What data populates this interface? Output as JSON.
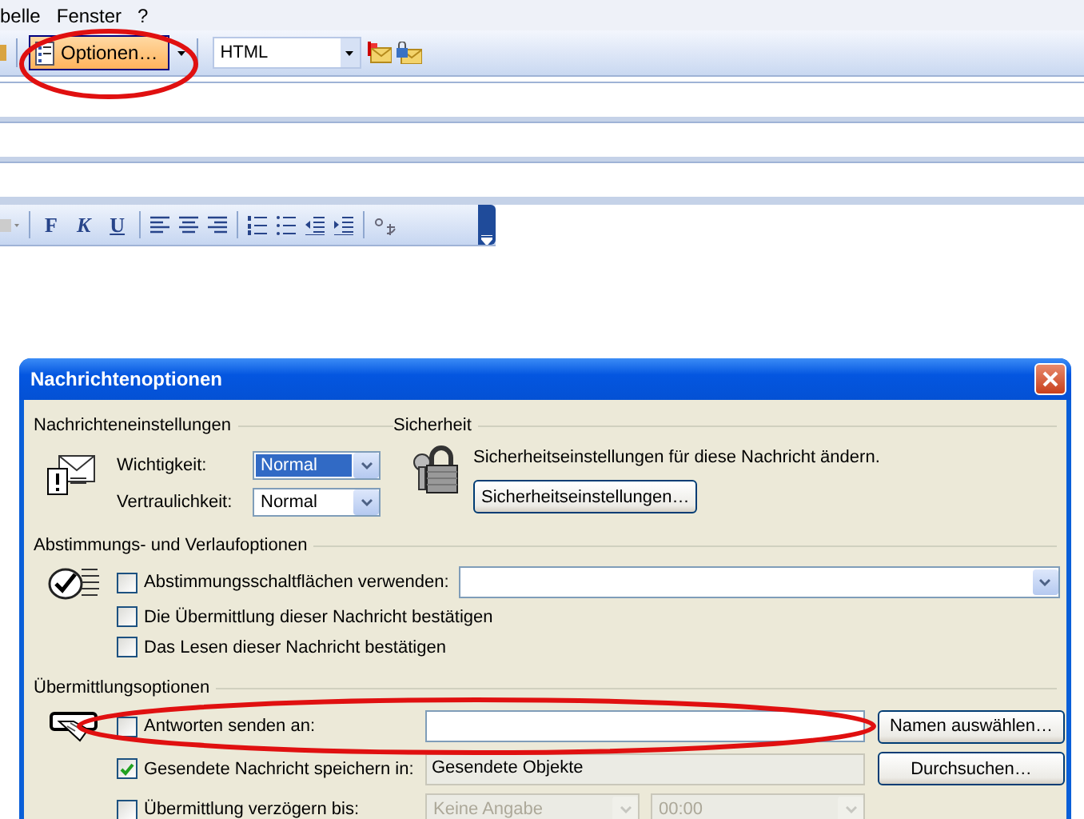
{
  "menu": [
    {
      "label": "belle"
    },
    {
      "label": "Fenster"
    },
    {
      "label": "?"
    }
  ],
  "toolbar": {
    "options_button": {
      "label": "Optionen…",
      "highlighted": true
    },
    "format_combo": {
      "value": "HTML"
    }
  },
  "format_toolbar": {
    "style_buttons": [
      {
        "label": "F",
        "kind": "bold"
      },
      {
        "label": "K",
        "kind": "italic"
      },
      {
        "label": "U",
        "kind": "underline"
      }
    ]
  },
  "dialog": {
    "title": "Nachrichtenoptionen",
    "settings": {
      "heading": "Nachrichteneinstellungen",
      "fields": [
        {
          "label": "Wichtigkeit:",
          "value": "Normal",
          "selected": true
        },
        {
          "label": "Vertraulichkeit:",
          "value": "Normal",
          "selected": false
        }
      ]
    },
    "security": {
      "heading": "Sicherheit",
      "text": "Sicherheitseinstellungen für diese Nachricht ändern.",
      "button": "Sicherheitseinstellungen…"
    },
    "tracking": {
      "heading": "Abstimmungs- und Verlaufoptionen",
      "options": [
        {
          "kind": "combo",
          "label": "Abstimmungsschaltflächen verwenden:",
          "checked": false
        },
        {
          "kind": "plain",
          "label": "Die Übermittlung dieser Nachricht bestätigen",
          "checked": false
        },
        {
          "kind": "plain",
          "label": "Das Lesen dieser Nachricht bestätigen",
          "checked": false
        }
      ]
    },
    "delivery": {
      "heading": "Übermittlungsoptionen",
      "options": [
        {
          "kind": "field",
          "label": "Antworten senden an:",
          "checked": false,
          "disabled": false,
          "button": "Namen auswählen…"
        },
        {
          "kind": "field",
          "label": "Gesendete Nachricht speichern in:",
          "checked": true,
          "disabled": true,
          "value": "Gesendete Objekte",
          "button": "Durchsuchen…"
        },
        {
          "kind": "combos",
          "label": "Übermittlung verzögern bis:",
          "checked": false,
          "disabled": true,
          "values": [
            "Keine Angabe",
            "00:00"
          ]
        }
      ]
    }
  },
  "annotations": [
    {
      "kind": "ellipse"
    },
    {
      "kind": "ellipse"
    }
  ]
}
